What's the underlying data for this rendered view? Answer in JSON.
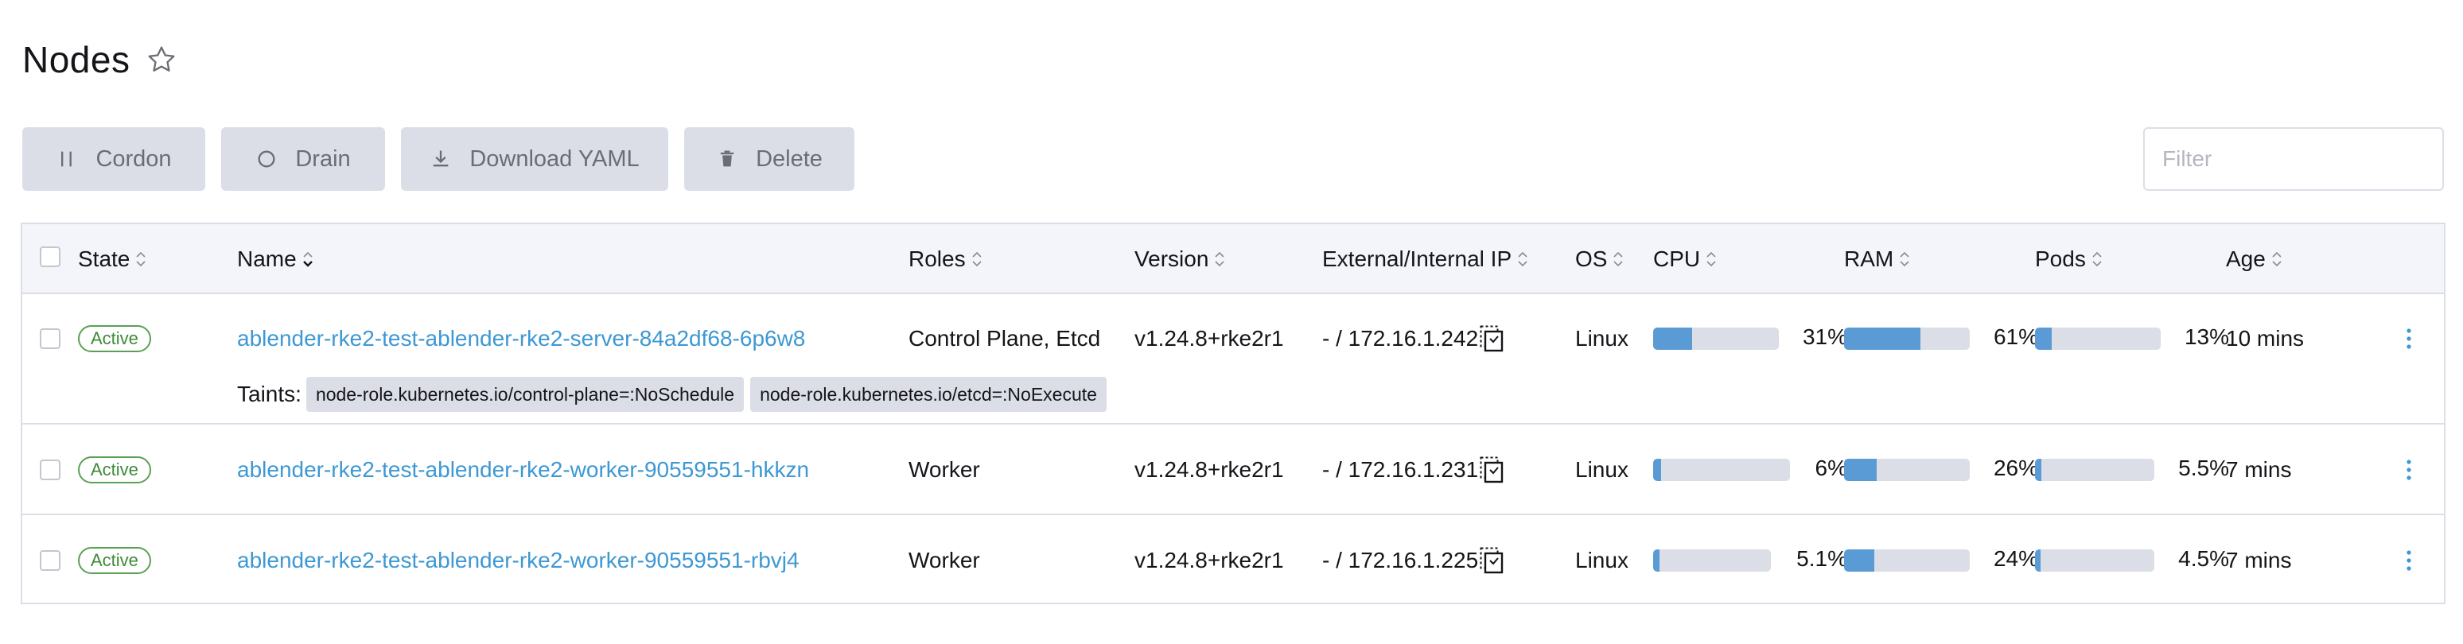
{
  "header": {
    "title": "Nodes"
  },
  "toolbar": {
    "cordon_label": "Cordon",
    "drain_label": "Drain",
    "download_yaml_label": "Download YAML",
    "delete_label": "Delete"
  },
  "filter": {
    "placeholder": "Filter",
    "value": ""
  },
  "table": {
    "columns": {
      "state": "State",
      "name": "Name",
      "roles": "Roles",
      "version": "Version",
      "ip": "External/Internal IP",
      "os": "OS",
      "cpu": "CPU",
      "ram": "RAM",
      "pods": "Pods",
      "age": "Age"
    },
    "taints_label": "Taints:",
    "rows": [
      {
        "state": "Active",
        "name": "ablender-rke2-test-ablender-rke2-server-84a2df68-6p6w8",
        "roles": "Control Plane, Etcd",
        "version": "v1.24.8+rke2r1",
        "ip": "- / 172.16.1.242",
        "os": "Linux",
        "cpu": {
          "label": "31%",
          "fraction": 0.31
        },
        "ram": {
          "label": "61%",
          "fraction": 0.61
        },
        "pods": {
          "label": "13%",
          "fraction": 0.13
        },
        "age": "10 mins",
        "taints": [
          "node-role.kubernetes.io/control-plane=:NoSchedule",
          "node-role.kubernetes.io/etcd=:NoExecute"
        ]
      },
      {
        "state": "Active",
        "name": "ablender-rke2-test-ablender-rke2-worker-90559551-hkkzn",
        "roles": "Worker",
        "version": "v1.24.8+rke2r1",
        "ip": "- / 172.16.1.231",
        "os": "Linux",
        "cpu": {
          "label": "6%",
          "fraction": 0.06
        },
        "ram": {
          "label": "26%",
          "fraction": 0.26
        },
        "pods": {
          "label": "5.5%",
          "fraction": 0.055
        },
        "age": "7 mins"
      },
      {
        "state": "Active",
        "name": "ablender-rke2-test-ablender-rke2-worker-90559551-rbvj4",
        "roles": "Worker",
        "version": "v1.24.8+rke2r1",
        "ip": "- / 172.16.1.225",
        "os": "Linux",
        "cpu": {
          "label": "5.1%",
          "fraction": 0.051
        },
        "ram": {
          "label": "24%",
          "fraction": 0.24
        },
        "pods": {
          "label": "4.5%",
          "fraction": 0.045
        },
        "age": "7 mins"
      }
    ]
  },
  "icons": {
    "favorite": "star-outline-icon",
    "cordon": "pause-icon",
    "drain": "circle-icon",
    "download": "download-icon",
    "delete": "trash-icon",
    "sort": "sort-icon",
    "copy": "copy-icon",
    "actions": "kebab-icon"
  },
  "colors": {
    "accent": "#3d98d3",
    "active_badge": "#5aa054",
    "bar_fill": "#5a9bd5",
    "button_bg": "#dcdee7"
  }
}
